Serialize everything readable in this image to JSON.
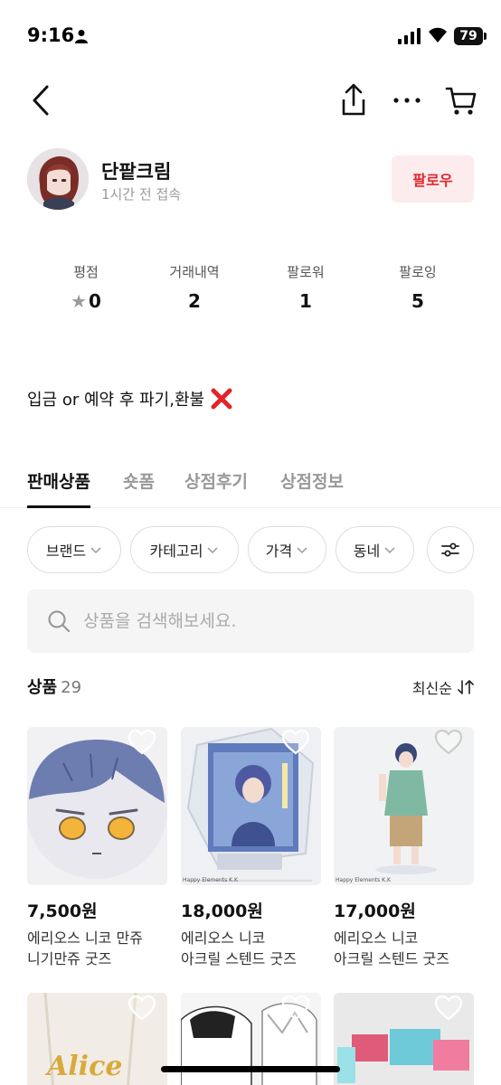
{
  "status_bar": {
    "time": "9:16",
    "battery": "79"
  },
  "profile": {
    "shop_name": "단팥크림",
    "last_seen": "1시간 전 접속",
    "follow_label": "팔로우"
  },
  "stats": [
    {
      "label": "평점",
      "value": "0"
    },
    {
      "label": "거래내역",
      "value": "2"
    },
    {
      "label": "팔로워",
      "value": "1"
    },
    {
      "label": "팔로잉",
      "value": "5"
    }
  ],
  "intro": {
    "text": "입금 or 예약 후 파기,환불"
  },
  "tabs": [
    "판매상품",
    "숏폼",
    "상점후기",
    "상점정보"
  ],
  "filters": [
    "브랜드",
    "카테고리",
    "가격",
    "동네"
  ],
  "search": {
    "placeholder": "상품을 검색해보세요."
  },
  "list": {
    "title": "상품",
    "count": "29",
    "sort_label": "최신순"
  },
  "products": [
    {
      "price": "7,500원",
      "name_line1": "에리오스 니코 만쥬",
      "name_line2": "니기만쥬 굿즈"
    },
    {
      "price": "18,000원",
      "name_line1": "에리오스 니코",
      "name_line2": "아크릴 스텐드 굿즈"
    },
    {
      "price": "17,000원",
      "name_line1": "에리오스 니코",
      "name_line2": "아크릴 스텐드 굿즈"
    }
  ],
  "thumb_text": {
    "brand_mark": "Happy Elements K.K",
    "row2_caption": "Alice"
  },
  "colors": {
    "accent": "#e0252f",
    "follow_bg": "#fdeced"
  }
}
